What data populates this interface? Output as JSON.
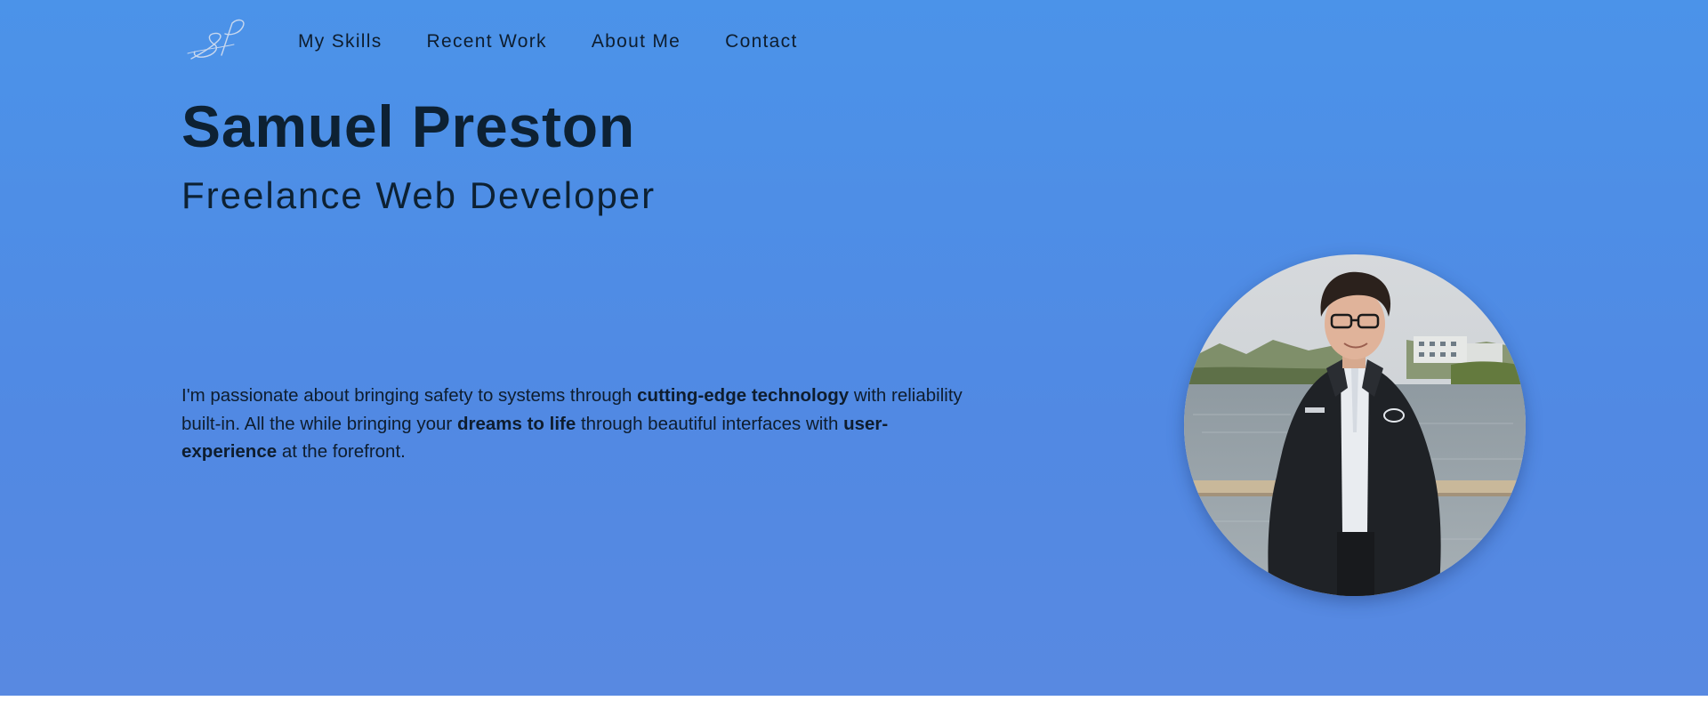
{
  "header": {
    "logo_text": "SP",
    "nav": [
      {
        "label": "My Skills"
      },
      {
        "label": "Recent Work"
      },
      {
        "label": "About Me"
      },
      {
        "label": "Contact"
      }
    ]
  },
  "hero": {
    "name": "Samuel Preston",
    "title": "Freelance Web Developer",
    "intro": {
      "part1": "I'm passionate about bringing safety to systems through ",
      "bold1": "cutting-edge technology",
      "part2": " with reliability built-in. All the while bringing your ",
      "bold2": "dreams to life",
      "part3": " through beautiful interfaces with ",
      "bold3": "user-experience",
      "part4": " at the forefront."
    }
  },
  "colors": {
    "hero_gradient_top": "#4b93e9",
    "hero_gradient_bottom": "#5889e1",
    "text_dark": "#0d2133"
  }
}
